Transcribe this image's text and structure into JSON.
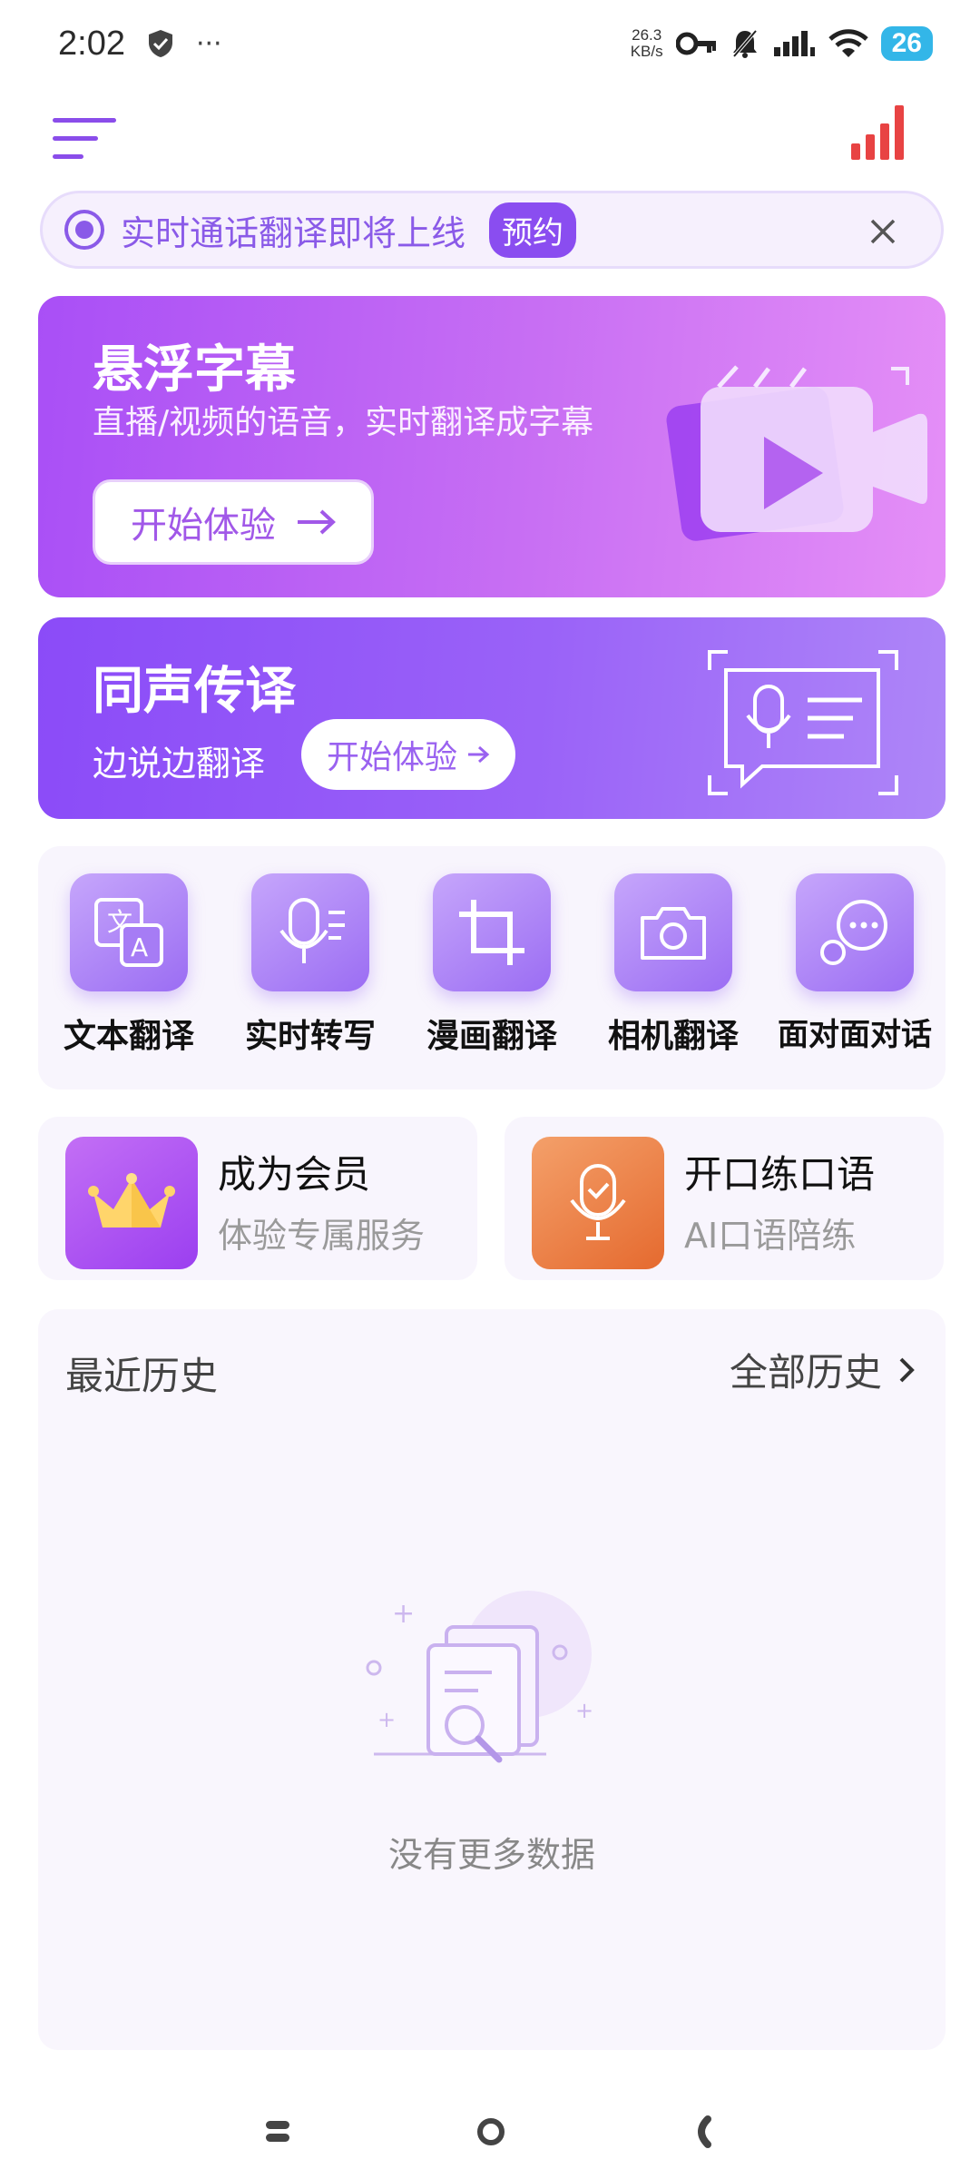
{
  "status_bar": {
    "time": "2:02",
    "more": "···",
    "net_speed_value": "26.3",
    "net_speed_unit": "KB/s",
    "battery": "26"
  },
  "notice": {
    "text": "实时通话翻译即将上线",
    "badge": "预约"
  },
  "floating_subtitle_card": {
    "title": "悬浮字幕",
    "subtitle": "直播/视频的语音，实时翻译成字幕",
    "button": "开始体验"
  },
  "simultaneous_card": {
    "title": "同声传译",
    "subtitle": "边说边翻译",
    "button": "开始体验"
  },
  "tools": [
    {
      "label": "文本翻译",
      "icon": "text-translate-icon"
    },
    {
      "label": "实时转写",
      "icon": "transcribe-icon"
    },
    {
      "label": "漫画翻译",
      "icon": "comic-translate-icon"
    },
    {
      "label": "相机翻译",
      "icon": "camera-icon"
    },
    {
      "label": "面对面对话",
      "icon": "dialog-icon"
    }
  ],
  "tiles": [
    {
      "title": "成为会员",
      "subtitle": "体验专属服务",
      "icon": "crown-icon"
    },
    {
      "title": "开口练口语",
      "subtitle": "AI口语陪练",
      "icon": "microphone-check-icon"
    }
  ],
  "history": {
    "title": "最近历史",
    "all_link": "全部历史",
    "empty_text": "没有更多数据"
  },
  "colors": {
    "accent": "#8a4df0",
    "float_card_start": "#a94ff6",
    "float_card_end": "#e58ff7",
    "sim_card_start": "#8b4bf8",
    "member_tile": "#a64df0",
    "speak_tile": "#ec7a3c",
    "stats_icon": "#e84343",
    "battery": "#33b6e8"
  }
}
